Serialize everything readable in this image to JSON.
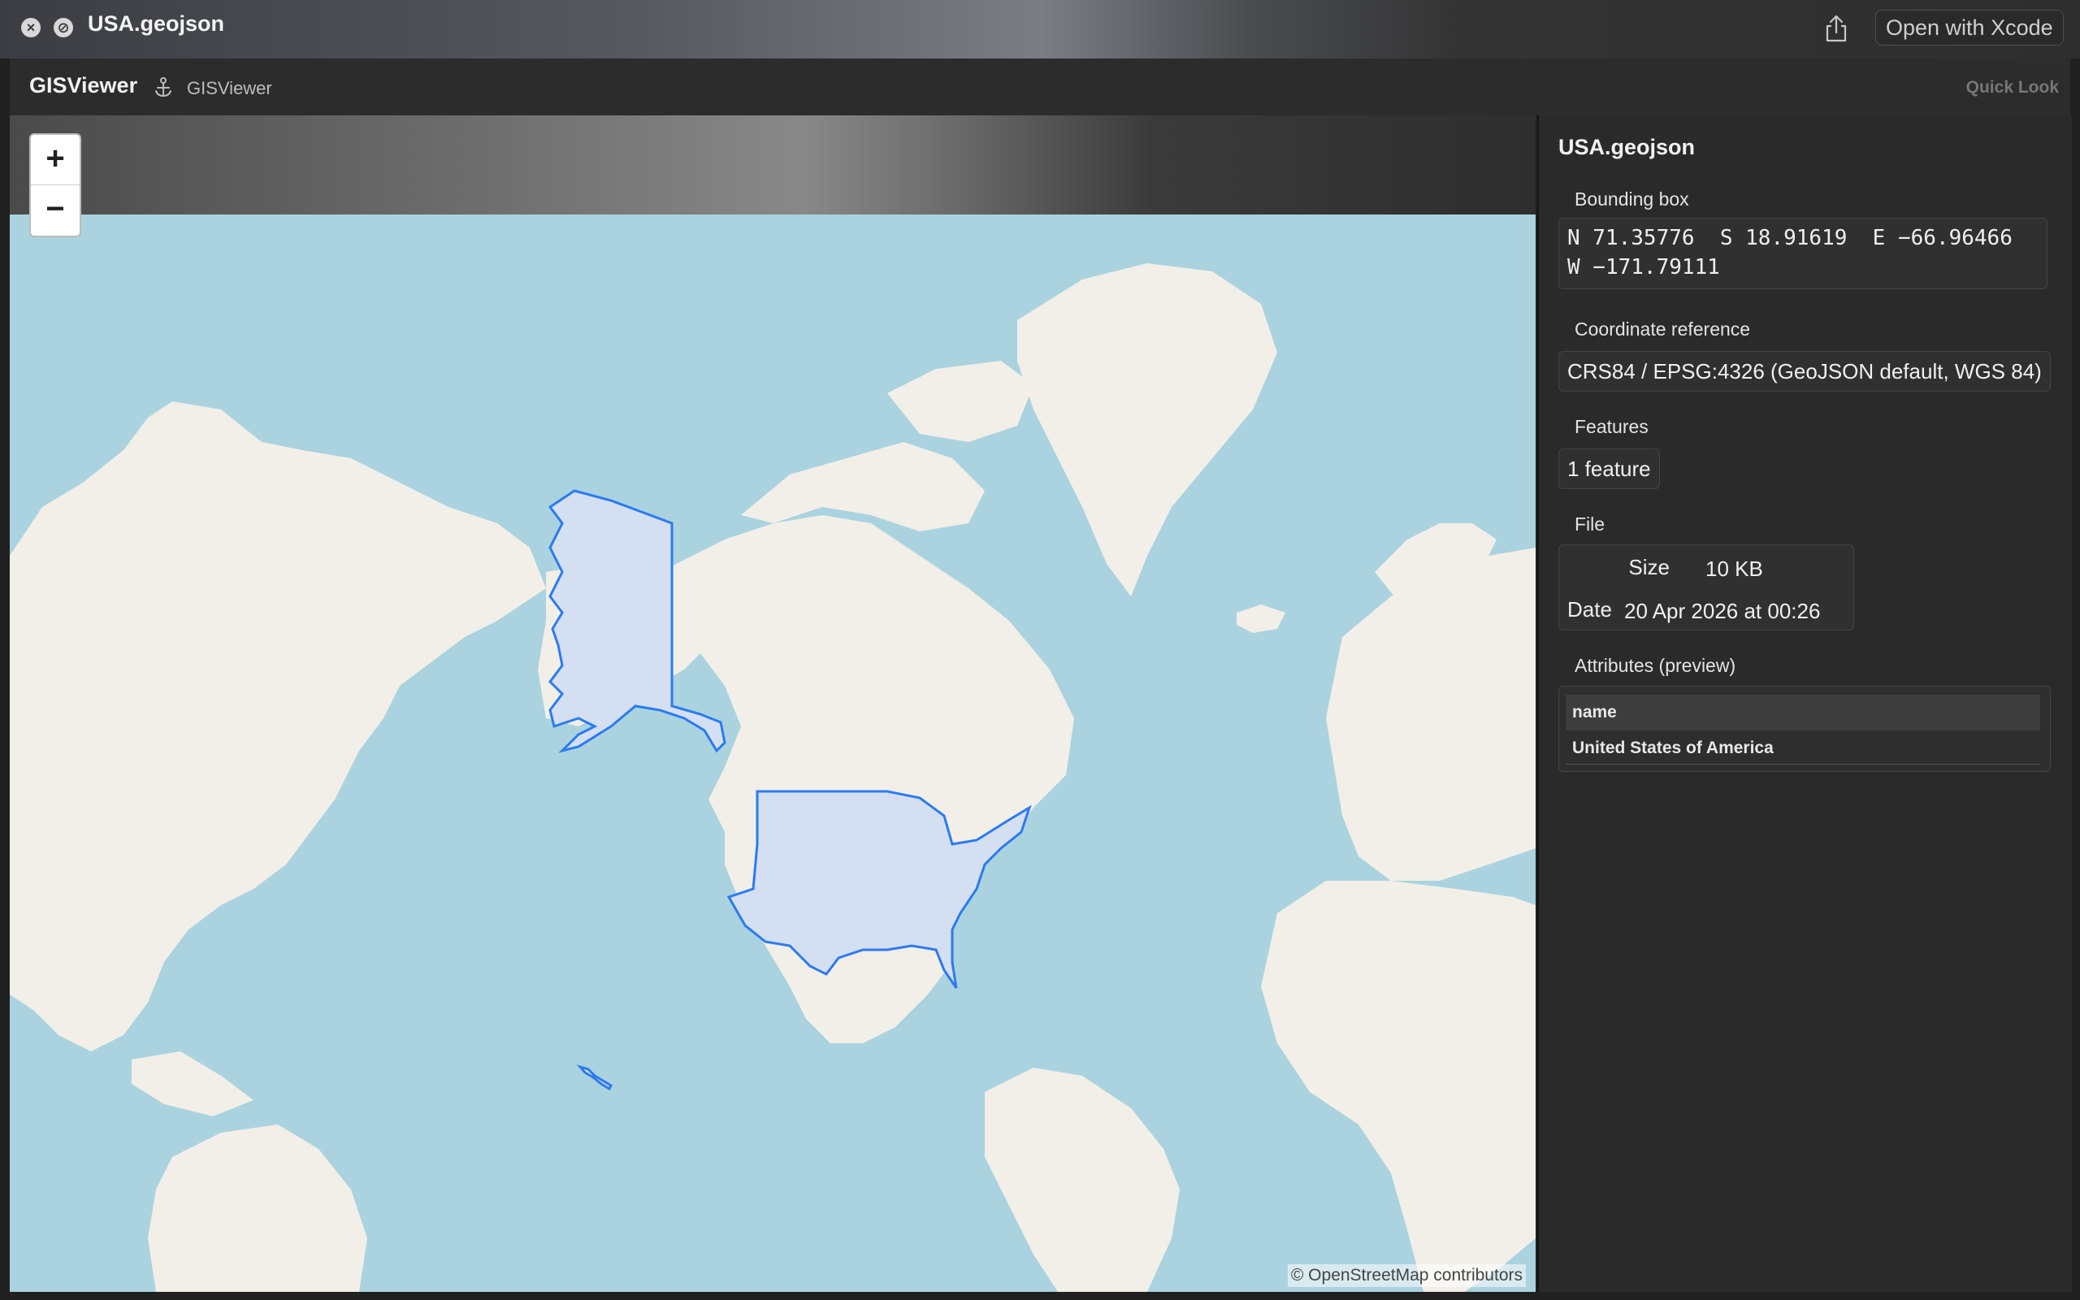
{
  "window": {
    "title": "USA.geojson",
    "open_with_label": "Open with Xcode"
  },
  "app_header": {
    "app_name": "GISViewer",
    "subtitle": "GISViewer",
    "quick_look_label": "Quick Look"
  },
  "map": {
    "zoom_in_label": "+",
    "zoom_out_label": "−",
    "attribution": "© OpenStreetMap contributors",
    "colors": {
      "water": "#aad3df",
      "land": "#f2efe9",
      "feature_fill": "#d4dff2",
      "feature_stroke": "#2b7bf0"
    }
  },
  "panel": {
    "title": "USA.geojson",
    "bounding_box_label": "Bounding box",
    "bounding_box_value": "N 71.35776  S 18.91619  E −66.96466\nW −171.79111",
    "crs_label": "Coordinate reference",
    "crs_value": "CRS84 / EPSG:4326 (GeoJSON default, WGS 84)",
    "features_label": "Features",
    "features_value": "1 feature",
    "file_label": "File",
    "size_label": "Size",
    "size_value": "10 KB",
    "date_label": "Date",
    "date_value": "20 Apr 2026 at 00:26",
    "attributes_label": "Attributes (preview)",
    "attributes_header": "name",
    "attributes_row": "United States of America"
  }
}
